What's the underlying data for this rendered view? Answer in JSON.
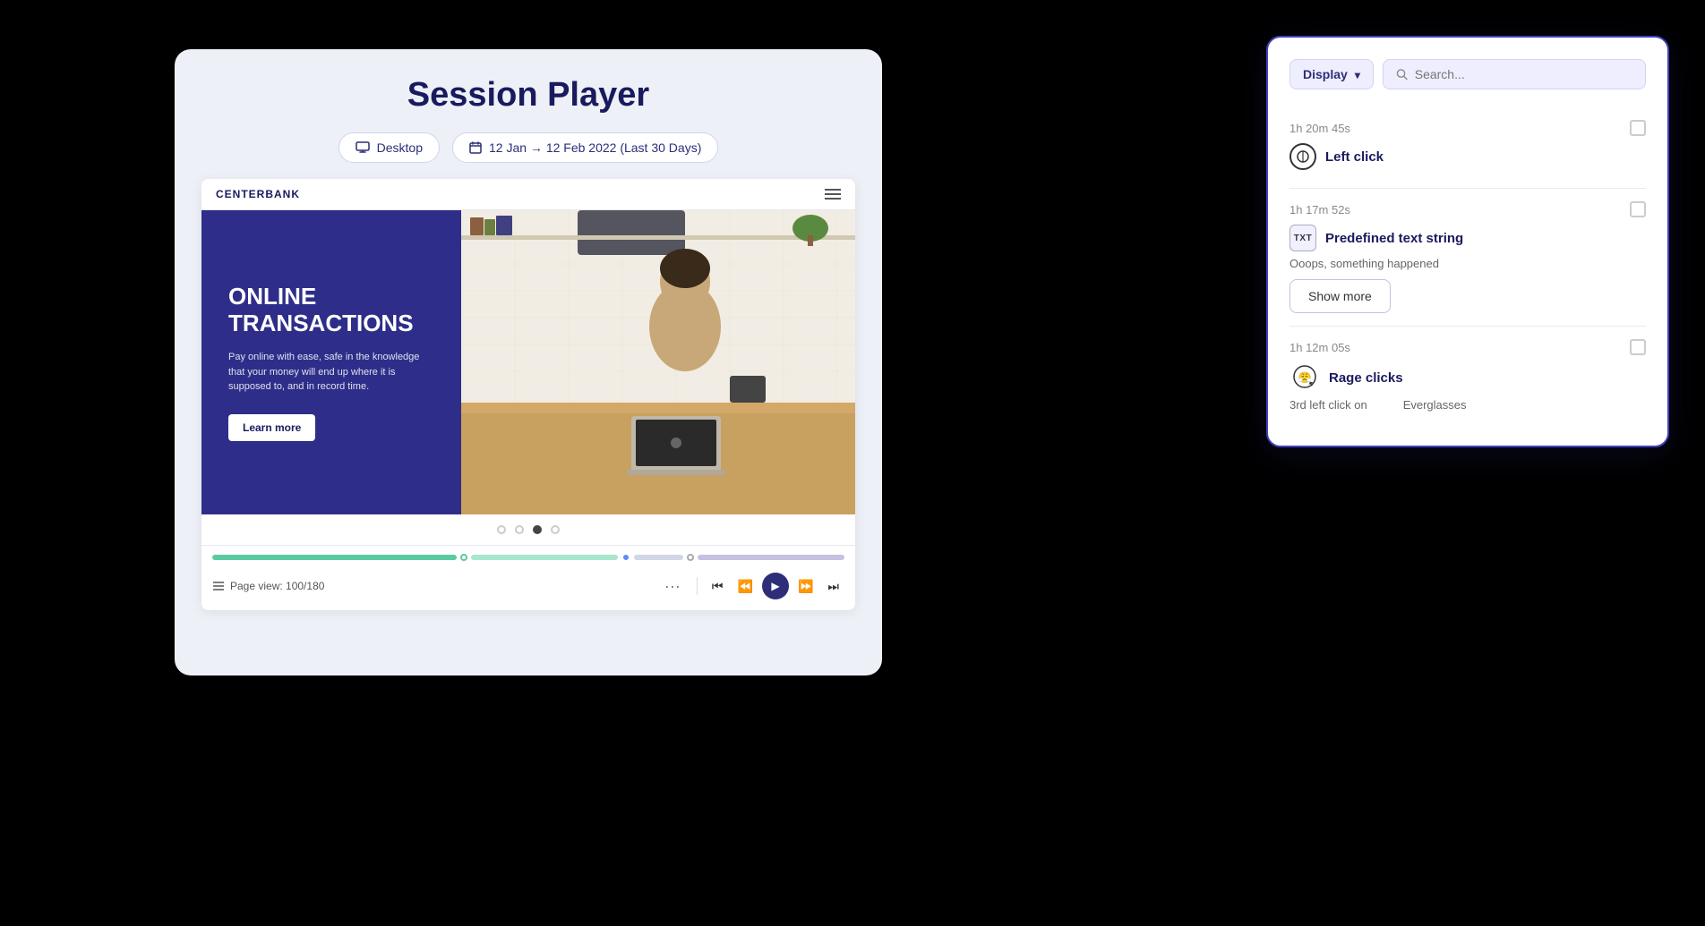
{
  "sessionPlayer": {
    "title": "Session Player",
    "deviceLabel": "Desktop",
    "dateRange": "12 Jan → 12 Feb 2022 (Last 30 Days)",
    "brandName": "CENTERBANK",
    "heroHeading": "ONLINE\nTRANSACTIONS",
    "heroSubtext": "Pay online with ease, safe in the knowledge that your money will end up where it is supposed to, and in record time.",
    "learnMoreLabel": "Learn more",
    "pageViewLabel": "Page view: 100/180",
    "carouselDots": [
      0,
      1,
      2,
      3
    ],
    "activeCarouselDot": 2
  },
  "eventsPanel": {
    "displayLabel": "Display",
    "searchPlaceholder": "Search...",
    "events": [
      {
        "time": "1h 20m 45s",
        "type": "Left click",
        "iconType": "click",
        "detail": null
      },
      {
        "time": "1h 17m 52s",
        "type": "Predefined text string",
        "iconType": "txt",
        "detail": "Ooops, something happened",
        "showMore": true
      },
      {
        "time": "1h 12m 05s",
        "type": "Rage clicks",
        "iconType": "rage",
        "detail1": "3rd left click on",
        "detail2": "Everglasses"
      }
    ],
    "showMoreLabel": "Show more"
  }
}
